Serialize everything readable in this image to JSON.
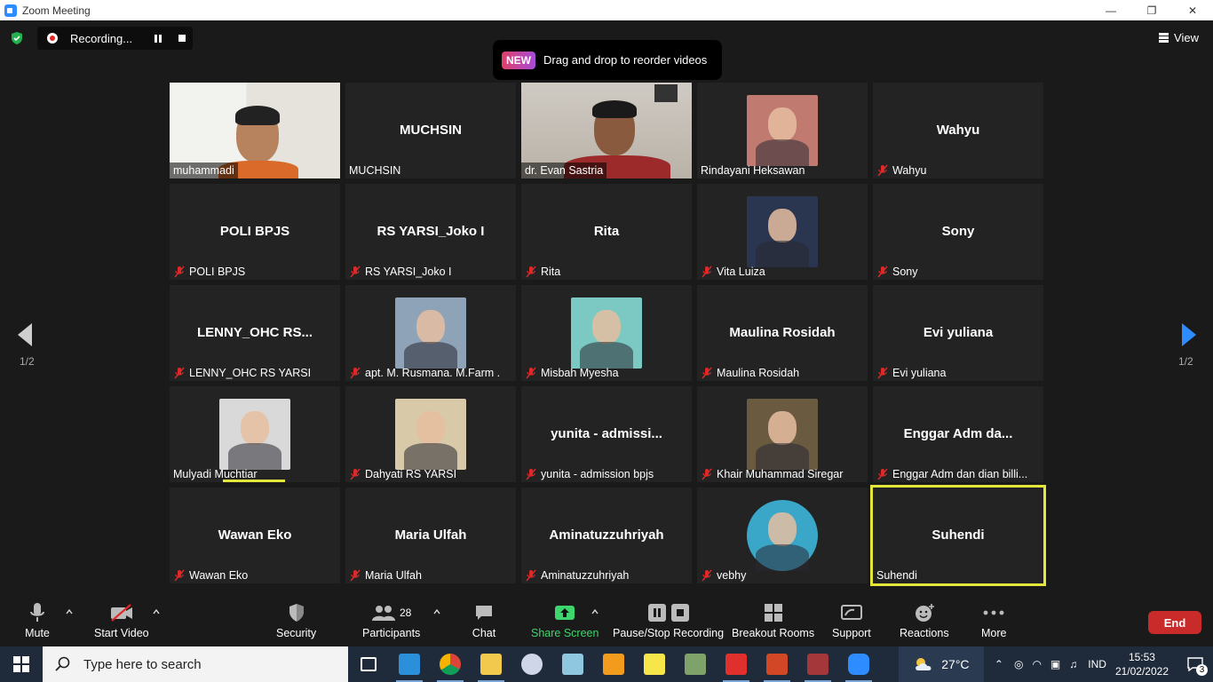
{
  "window": {
    "title": "Zoom Meeting",
    "controls": [
      "—",
      "❐",
      "✕"
    ]
  },
  "recording": {
    "label": "Recording..."
  },
  "view_button": {
    "label": "View"
  },
  "banner": {
    "badge": "NEW",
    "text": "Drag and drop to reorder videos"
  },
  "pagination": {
    "left": "1/2",
    "right": "1/2"
  },
  "tiles": [
    {
      "big": "",
      "caption": "muhammadi",
      "muted": false,
      "kind": "video1"
    },
    {
      "big": "MUCHSIN",
      "caption": "MUCHSIN",
      "muted": false,
      "kind": "blank"
    },
    {
      "big": "",
      "caption": "dr. Evan Sastria",
      "muted": false,
      "kind": "video2"
    },
    {
      "big": "",
      "caption": "Rindayani Heksawan",
      "muted": false,
      "kind": "photo",
      "photo": "#c07a70"
    },
    {
      "big": "Wahyu",
      "caption": "Wahyu",
      "muted": true,
      "kind": "blank"
    },
    {
      "big": "POLI BPJS",
      "caption": "POLI BPJS",
      "muted": true,
      "kind": "blank"
    },
    {
      "big": "RS YARSI_Joko I",
      "caption": "RS YARSI_Joko I",
      "muted": true,
      "kind": "blank"
    },
    {
      "big": "Rita",
      "caption": "Rita",
      "muted": true,
      "kind": "blank"
    },
    {
      "big": "",
      "caption": "Vita Luiza",
      "muted": true,
      "kind": "photo",
      "photo": "#2a3550"
    },
    {
      "big": "Sony",
      "caption": "Sony",
      "muted": true,
      "kind": "blank"
    },
    {
      "big": "LENNY_OHC  RS...",
      "caption": "LENNY_OHC RS YARSI",
      "muted": true,
      "kind": "blank"
    },
    {
      "big": "",
      "caption": "apt. M. Rusmana. M.Farm .",
      "muted": true,
      "kind": "photo",
      "photo": "#8fa3b8"
    },
    {
      "big": "",
      "caption": "Misbah Myesha",
      "muted": true,
      "kind": "photo",
      "photo": "#7cc9c4"
    },
    {
      "big": "Maulina Rosidah",
      "caption": "Maulina Rosidah",
      "muted": true,
      "kind": "blank"
    },
    {
      "big": "Evi yuliana",
      "caption": "Evi yuliana",
      "muted": true,
      "kind": "blank"
    },
    {
      "big": "",
      "caption": "Mulyadi Muchtiar",
      "muted": false,
      "kind": "photo",
      "photo": "#d9d9d9"
    },
    {
      "big": "",
      "caption": "Dahyati RS YARSI",
      "muted": true,
      "kind": "photo",
      "photo": "#d8c9a8"
    },
    {
      "big": "yunita  -  admissi...",
      "caption": "yunita - admission bpjs",
      "muted": true,
      "kind": "blank"
    },
    {
      "big": "",
      "caption": "Khair Muhammad Siregar",
      "muted": true,
      "kind": "photo",
      "photo": "#6a5a40"
    },
    {
      "big": "Enggar  Adm  da...",
      "caption": "Enggar Adm dan dian billi...",
      "muted": true,
      "kind": "blank"
    },
    {
      "big": "Wawan Eko",
      "caption": "Wawan Eko",
      "muted": true,
      "kind": "blank"
    },
    {
      "big": "Maria Ulfah",
      "caption": "Maria Ulfah",
      "muted": true,
      "kind": "blank"
    },
    {
      "big": "Aminatuzzuhriyah",
      "caption": "Aminatuzzuhriyah",
      "muted": true,
      "kind": "blank"
    },
    {
      "big": "",
      "caption": "vebhy",
      "muted": true,
      "kind": "photo-round",
      "photo": "#3aa7c9"
    },
    {
      "big": "Suhendi",
      "caption": "Suhendi",
      "muted": false,
      "kind": "blank",
      "active": true
    }
  ],
  "toolbar": {
    "mute": "Mute",
    "start_video": "Start Video",
    "security": "Security",
    "participants": "Participants",
    "participants_count": "28",
    "chat": "Chat",
    "share_screen": "Share Screen",
    "pause_stop_recording": "Pause/Stop Recording",
    "breakout_rooms": "Breakout Rooms",
    "support": "Support",
    "reactions": "Reactions",
    "more": "More",
    "end": "End"
  },
  "taskbar": {
    "search_placeholder": "Type here to search",
    "temperature": "27°C",
    "language": "IND",
    "time": "15:53",
    "date": "21/02/2022",
    "notifications": "3"
  },
  "colors": {
    "active_speaker": "#e5e63a",
    "share_green": "#3dd56d",
    "end_red": "#c92a2a",
    "mic_off_red": "#e02828"
  }
}
